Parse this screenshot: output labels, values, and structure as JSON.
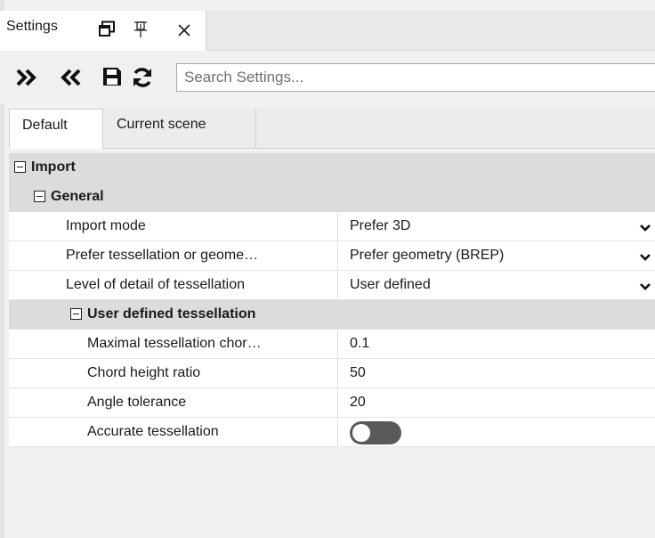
{
  "panel": {
    "title": "Settings"
  },
  "toolbar": {
    "expand_all_icon": "double-chevron-right",
    "collapse_all_icon": "double-chevron-left",
    "save_icon": "floppy-disk",
    "reload_icon": "refresh",
    "search_placeholder": "Search Settings..."
  },
  "scope_tabs": [
    {
      "label": "Default",
      "active": true
    },
    {
      "label": "Current scene",
      "active": false
    }
  ],
  "rows": [
    {
      "kind": "group",
      "label": "Import"
    },
    {
      "kind": "group",
      "label": "General"
    },
    {
      "kind": "prop",
      "name": "Import mode",
      "value": "Prefer 3D",
      "dropdown": true
    },
    {
      "kind": "prop",
      "name": "Prefer tessellation or geome…",
      "value": "Prefer geometry (BREP)",
      "dropdown": true
    },
    {
      "kind": "prop",
      "name": "Level of detail of tessellation",
      "value": "User defined",
      "dropdown": true
    },
    {
      "kind": "group",
      "label": "User defined tessellation"
    },
    {
      "kind": "prop",
      "name": "Maximal tessellation chor…",
      "value": "0.1"
    },
    {
      "kind": "prop",
      "name": "Chord height ratio",
      "value": "50"
    },
    {
      "kind": "prop",
      "name": "Angle tolerance",
      "value": "20"
    },
    {
      "kind": "prop",
      "name": "Accurate tessellation",
      "value_toggle": false
    }
  ],
  "colors": {
    "group_bg": "#dcdcdc",
    "toggle_off": "#5a5a5a"
  }
}
